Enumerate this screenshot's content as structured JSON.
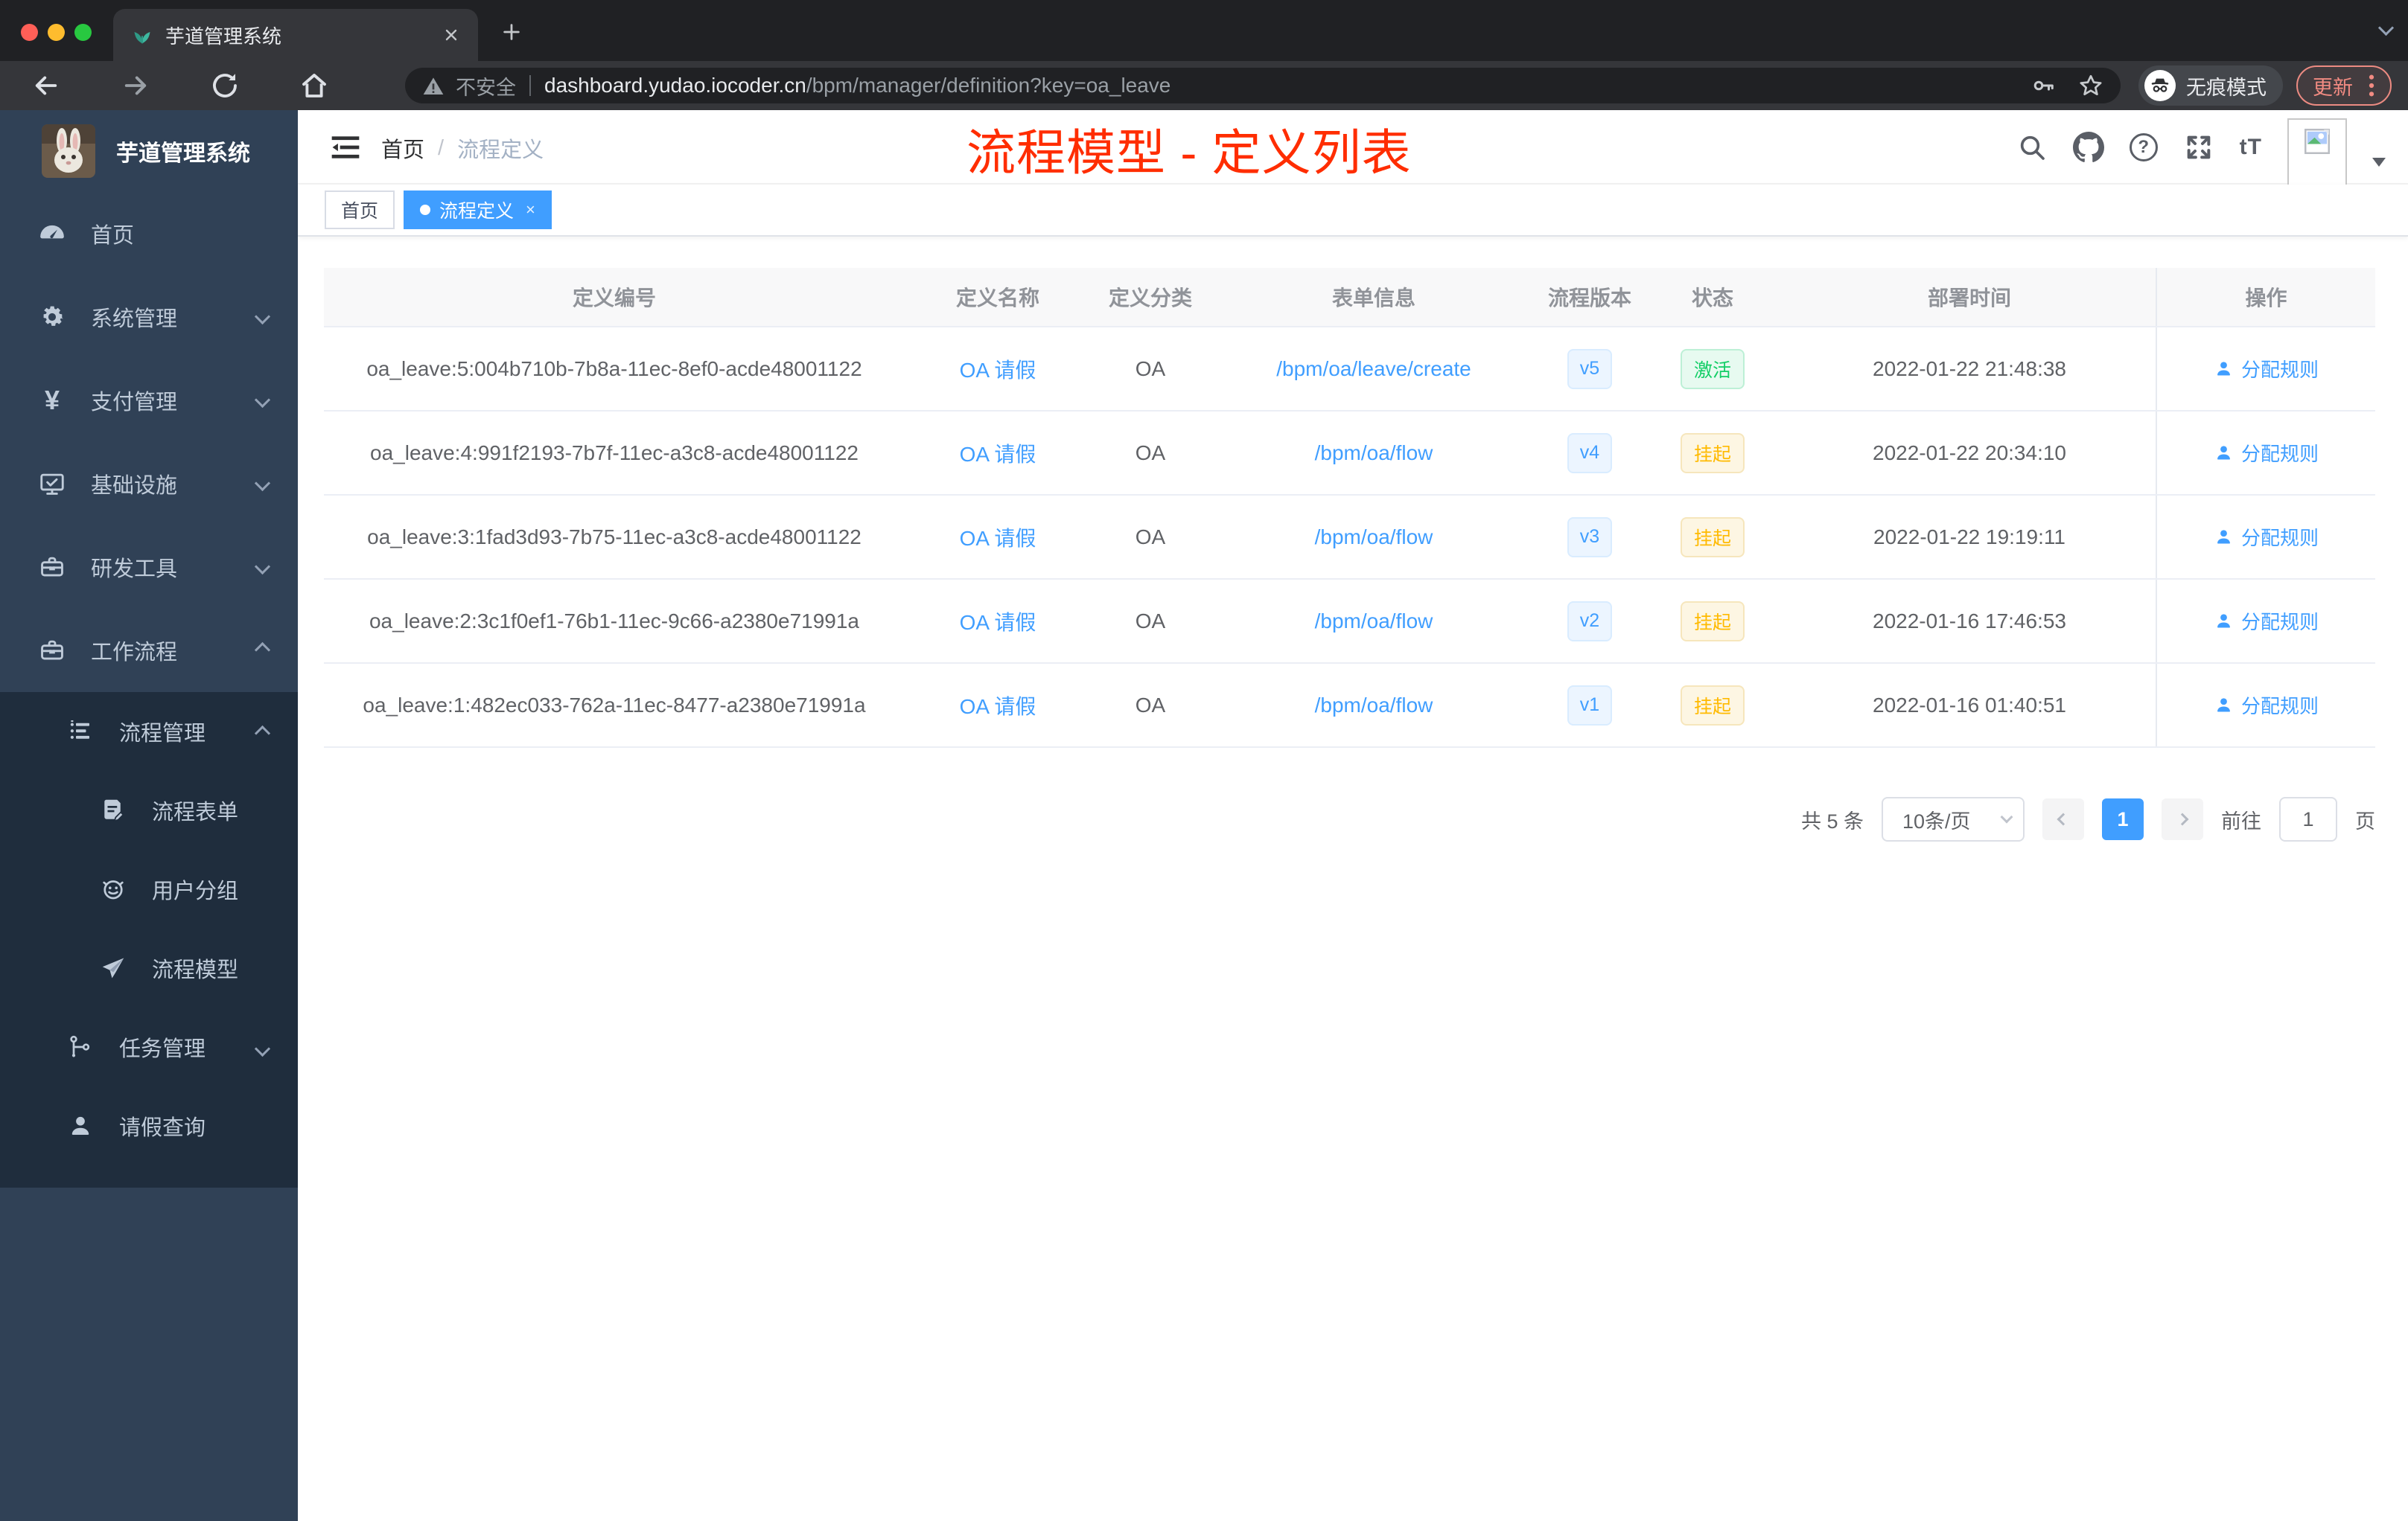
{
  "browser": {
    "tab_title": "芋道管理系统",
    "security_label": "不安全",
    "url_host": "dashboard.yudao.iocoder.cn",
    "url_path": "/bpm/manager/definition?key=oa_leave",
    "incognito_label": "无痕模式",
    "update_label": "更新"
  },
  "sidebar": {
    "app_title": "芋道管理系统",
    "items": [
      {
        "label": "首页",
        "icon": "dashboard-icon"
      },
      {
        "label": "系统管理",
        "icon": "gear-icon",
        "chevron": "down"
      },
      {
        "label": "支付管理",
        "icon": "yen-icon",
        "icon_glyph": "¥",
        "chevron": "down"
      },
      {
        "label": "基础设施",
        "icon": "monitor-check-icon",
        "chevron": "down"
      },
      {
        "label": "研发工具",
        "icon": "toolbox-icon",
        "chevron": "down"
      },
      {
        "label": "工作流程",
        "icon": "briefcase-icon",
        "chevron": "up"
      }
    ],
    "submenu": [
      {
        "label": "流程管理",
        "level": 2,
        "icon": "tree-list-icon",
        "chevron": "up"
      },
      {
        "label": "流程表单",
        "level": 3,
        "icon": "form-edit-icon"
      },
      {
        "label": "用户分组",
        "level": 3,
        "icon": "user-group-icon"
      },
      {
        "label": "流程模型",
        "level": 3,
        "icon": "paper-plane-icon"
      },
      {
        "label": "任务管理",
        "level": 2,
        "icon": "org-tree-icon",
        "chevron": "down"
      },
      {
        "label": "请假查询",
        "level": 2,
        "icon": "person-icon"
      }
    ]
  },
  "header": {
    "breadcrumb": [
      "首页",
      "流程定义"
    ],
    "breadcrumb_separator": "/",
    "help_icon_text": "?",
    "font_size_icon_text": "tT"
  },
  "annotation": {
    "text": "流程模型 - 定义列表",
    "color": "#ff2d00"
  },
  "tags": [
    {
      "label": "首页",
      "active": false
    },
    {
      "label": "流程定义",
      "active": true,
      "closable": true
    }
  ],
  "table": {
    "columns": [
      "定义编号",
      "定义名称",
      "定义分类",
      "表单信息",
      "流程版本",
      "状态",
      "部署时间",
      "操作"
    ],
    "rows": [
      {
        "id": "oa_leave:5:004b710b-7b8a-11ec-8ef0-acde48001122",
        "name": "OA 请假",
        "category": "OA",
        "form": "/bpm/oa/leave/create",
        "version": "v5",
        "status": "激活",
        "status_type": "success",
        "deploy_time": "2022-01-22 21:48:38",
        "action": "分配规则"
      },
      {
        "id": "oa_leave:4:991f2193-7b7f-11ec-a3c8-acde48001122",
        "name": "OA 请假",
        "category": "OA",
        "form": "/bpm/oa/flow",
        "version": "v4",
        "status": "挂起",
        "status_type": "warning",
        "deploy_time": "2022-01-22 20:34:10",
        "action": "分配规则"
      },
      {
        "id": "oa_leave:3:1fad3d93-7b75-11ec-a3c8-acde48001122",
        "name": "OA 请假",
        "category": "OA",
        "form": "/bpm/oa/flow",
        "version": "v3",
        "status": "挂起",
        "status_type": "warning",
        "deploy_time": "2022-01-22 19:19:11",
        "action": "分配规则"
      },
      {
        "id": "oa_leave:2:3c1f0ef1-76b1-11ec-9c66-a2380e71991a",
        "name": "OA 请假",
        "category": "OA",
        "form": "/bpm/oa/flow",
        "version": "v2",
        "status": "挂起",
        "status_type": "warning",
        "deploy_time": "2022-01-16 17:46:53",
        "action": "分配规则"
      },
      {
        "id": "oa_leave:1:482ec033-762a-11ec-8477-a2380e71991a",
        "name": "OA 请假",
        "category": "OA",
        "form": "/bpm/oa/flow",
        "version": "v1",
        "status": "挂起",
        "status_type": "warning",
        "deploy_time": "2022-01-16 01:40:51",
        "action": "分配规则"
      }
    ]
  },
  "pagination": {
    "total_label": "共 5 条",
    "page_size": "10条/页",
    "current_page": "1",
    "goto_label": "前往",
    "goto_value": "1",
    "page_label": "页"
  },
  "icons": [
    "tab-favicon-icon",
    "close-icon",
    "new-tab-icon",
    "back-icon",
    "forward-icon",
    "reload-icon",
    "home-icon",
    "warning-icon",
    "key-icon",
    "star-icon",
    "incognito-icon",
    "more-dots-icon",
    "hamburger-icon",
    "search-icon",
    "github-icon",
    "help-icon",
    "fullscreen-icon",
    "font-size-icon",
    "broken-image-icon",
    "caret-down-icon",
    "dashboard-icon",
    "gear-icon",
    "yen-icon",
    "monitor-check-icon",
    "toolbox-icon",
    "briefcase-icon",
    "tree-list-icon",
    "form-edit-icon",
    "user-group-icon",
    "paper-plane-icon",
    "org-tree-icon",
    "person-icon",
    "user-icon"
  ],
  "colors": {
    "accent_blue": "#409eff",
    "success_green": "#13ce66",
    "warning_orange": "#ffba00",
    "annotation_red": "#ff2d00",
    "sidebar_bg": "#304156",
    "submenu_bg": "#1f2d3d",
    "chrome_bg": "#202124",
    "toolbar_bg": "#35363a"
  }
}
